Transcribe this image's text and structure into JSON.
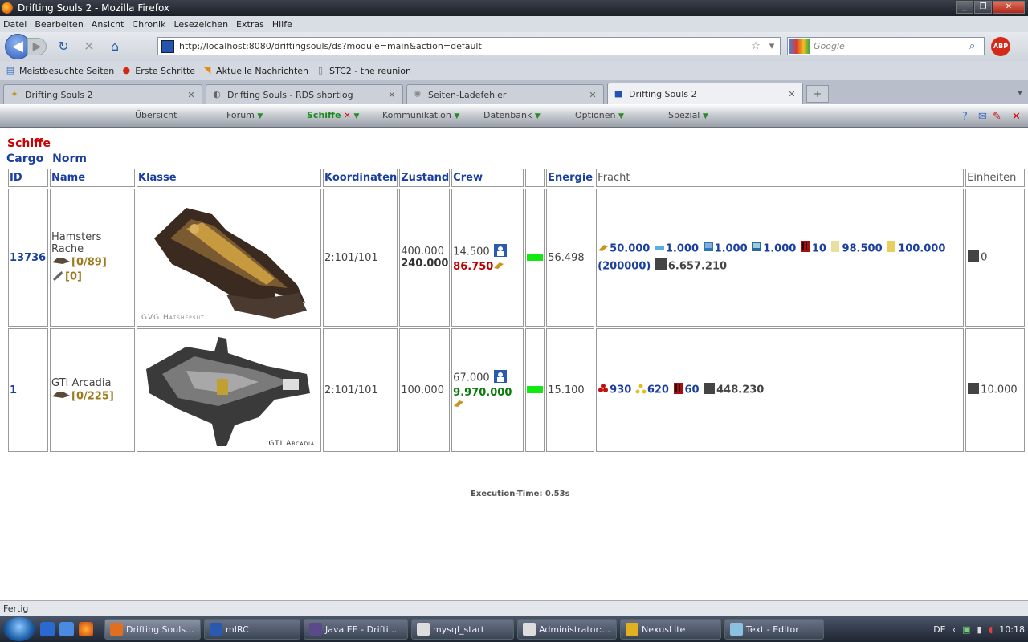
{
  "window": {
    "title": "Drifting Souls 2 - Mozilla Firefox"
  },
  "menu": [
    "Datei",
    "Bearbeiten",
    "Ansicht",
    "Chronik",
    "Lesezeichen",
    "Extras",
    "Hilfe"
  ],
  "nav": {
    "url": "http://localhost:8080/driftingsouls/ds?module=main&action=default",
    "search_placeholder": "Google",
    "abp_label": "ABP"
  },
  "bookmarks": [
    "Meistbesuchte Seiten",
    "Erste Schritte",
    "Aktuelle Nachrichten",
    "STC2 - the reunion"
  ],
  "tabs": [
    {
      "label": "Drifting Souls 2",
      "active": false
    },
    {
      "label": "Drifting Souls - RDS shortlog",
      "active": false
    },
    {
      "label": "Seiten-Ladefehler",
      "active": false
    },
    {
      "label": "Drifting Souls 2",
      "active": true
    }
  ],
  "gamenav": {
    "items": [
      "Übersicht",
      "Forum",
      "Schiffe",
      "Kommunikation",
      "Datenbank",
      "Optionen",
      "Spezial"
    ],
    "current": "Schiffe"
  },
  "page": {
    "heading": "Schiffe",
    "subnav": [
      "Cargo",
      "Norm"
    ],
    "exec_time": "Execution-Time: 0.53s"
  },
  "table": {
    "headers": {
      "id": "ID",
      "name": "Name",
      "klasse": "Klasse",
      "koordinaten": "Koordinaten",
      "zustand": "Zustand",
      "crew": "Crew",
      "blank": "",
      "energie": "Energie",
      "fracht": "Fracht",
      "einheiten": "Einheiten"
    },
    "rows": [
      {
        "id": "13736",
        "name_line1": "Hamsters",
        "name_line2": "Rache",
        "dock1": "[0/89]",
        "dock2": "[0]",
        "class_caption": "GVG Hatshepsut",
        "koordinaten": "2:101/101",
        "zustand1": "400.000",
        "zustand2": "240.000",
        "crew1": "14.500",
        "crew2": "86.750",
        "energie": "56.498",
        "fracht": [
          "50.000",
          "1.000",
          "1.000",
          "1.000",
          "10",
          "98.500",
          "100.000"
        ],
        "fracht_extra": "(200000)",
        "fracht_last": "6.657.210",
        "einheiten": "0"
      },
      {
        "id": "1",
        "name_line1": "GTI Arcadia",
        "dock1": "[0/225]",
        "class_caption": "GTI Arcadia",
        "koordinaten": "2:101/101",
        "zustand1": "100.000",
        "crew1": "67.000",
        "crew2": "9.970.000",
        "energie": "15.100",
        "fracht": [
          "930",
          "620",
          "60",
          "448.230"
        ],
        "einheiten": "10.000"
      }
    ]
  },
  "status": "Fertig",
  "taskbar": {
    "tasks": [
      "Drifting Souls...",
      "mIRC",
      "Java EE - Drifti...",
      "mysql_start",
      "Administrator:...",
      "NexusLite",
      "Text - Editor"
    ],
    "lang": "DE",
    "time": "10:18"
  },
  "colors": {
    "heading": "#cc0000",
    "link": "#1a3fa0",
    "energy_bar": "#12e812",
    "gold": "#9a7a1a"
  }
}
